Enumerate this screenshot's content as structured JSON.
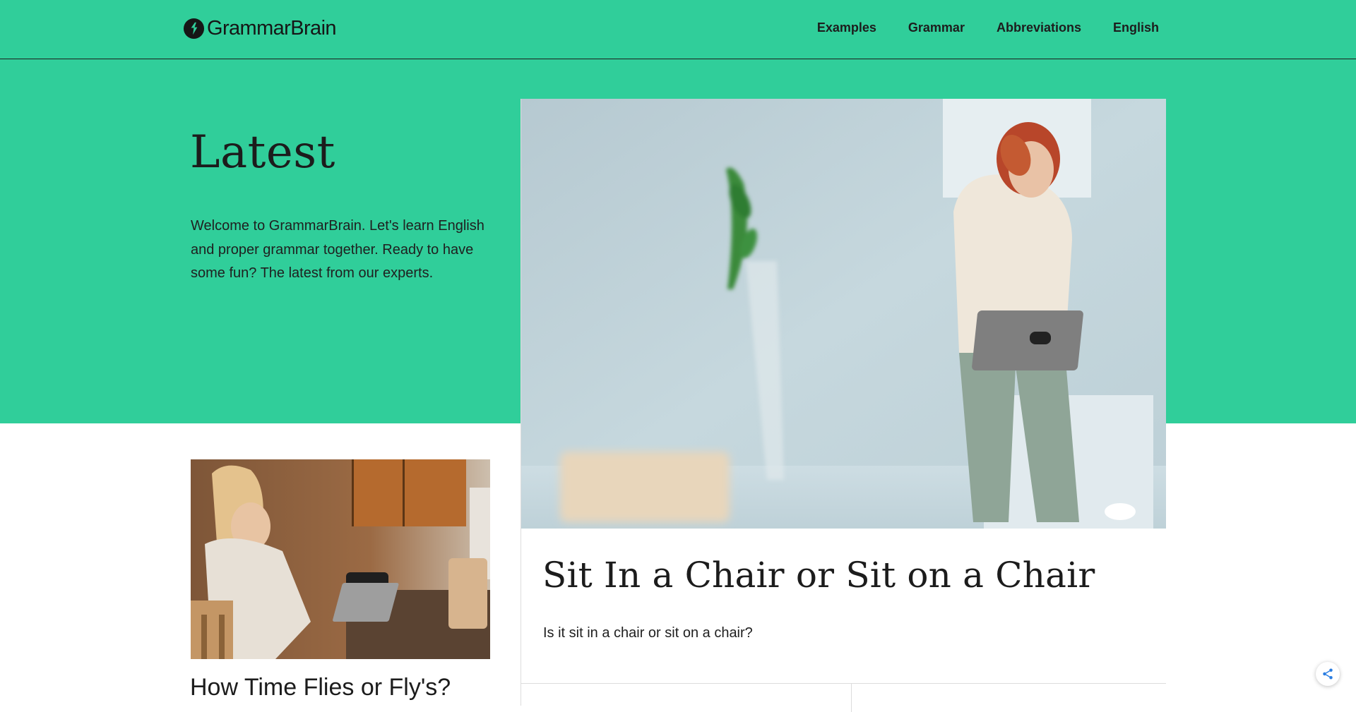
{
  "header": {
    "brand": "GrammarBrain",
    "nav": [
      "Examples",
      "Grammar",
      "Abbreviations",
      "English"
    ]
  },
  "hero": {
    "title": "Latest",
    "intro": "Welcome to GrammarBrain. Let's learn English and proper grammar together. Ready to have some fun? The latest from our experts."
  },
  "featured_post": {
    "title": "Sit In a Chair or Sit on a Chair",
    "excerpt": "Is it sit in a chair or sit on a chair?",
    "image": "photo-woman-on-chair-with-laptop"
  },
  "side_post": {
    "title": "How Time Flies or Fly's?",
    "image": "photo-woman-writing-in-kitchen"
  },
  "icons": {
    "logo": "grammarbrain-logo-icon",
    "share": "share-icon"
  },
  "colors": {
    "brand": "#30ce9a",
    "text": "#1c1c1c",
    "share_accent": "#2a7de1"
  }
}
